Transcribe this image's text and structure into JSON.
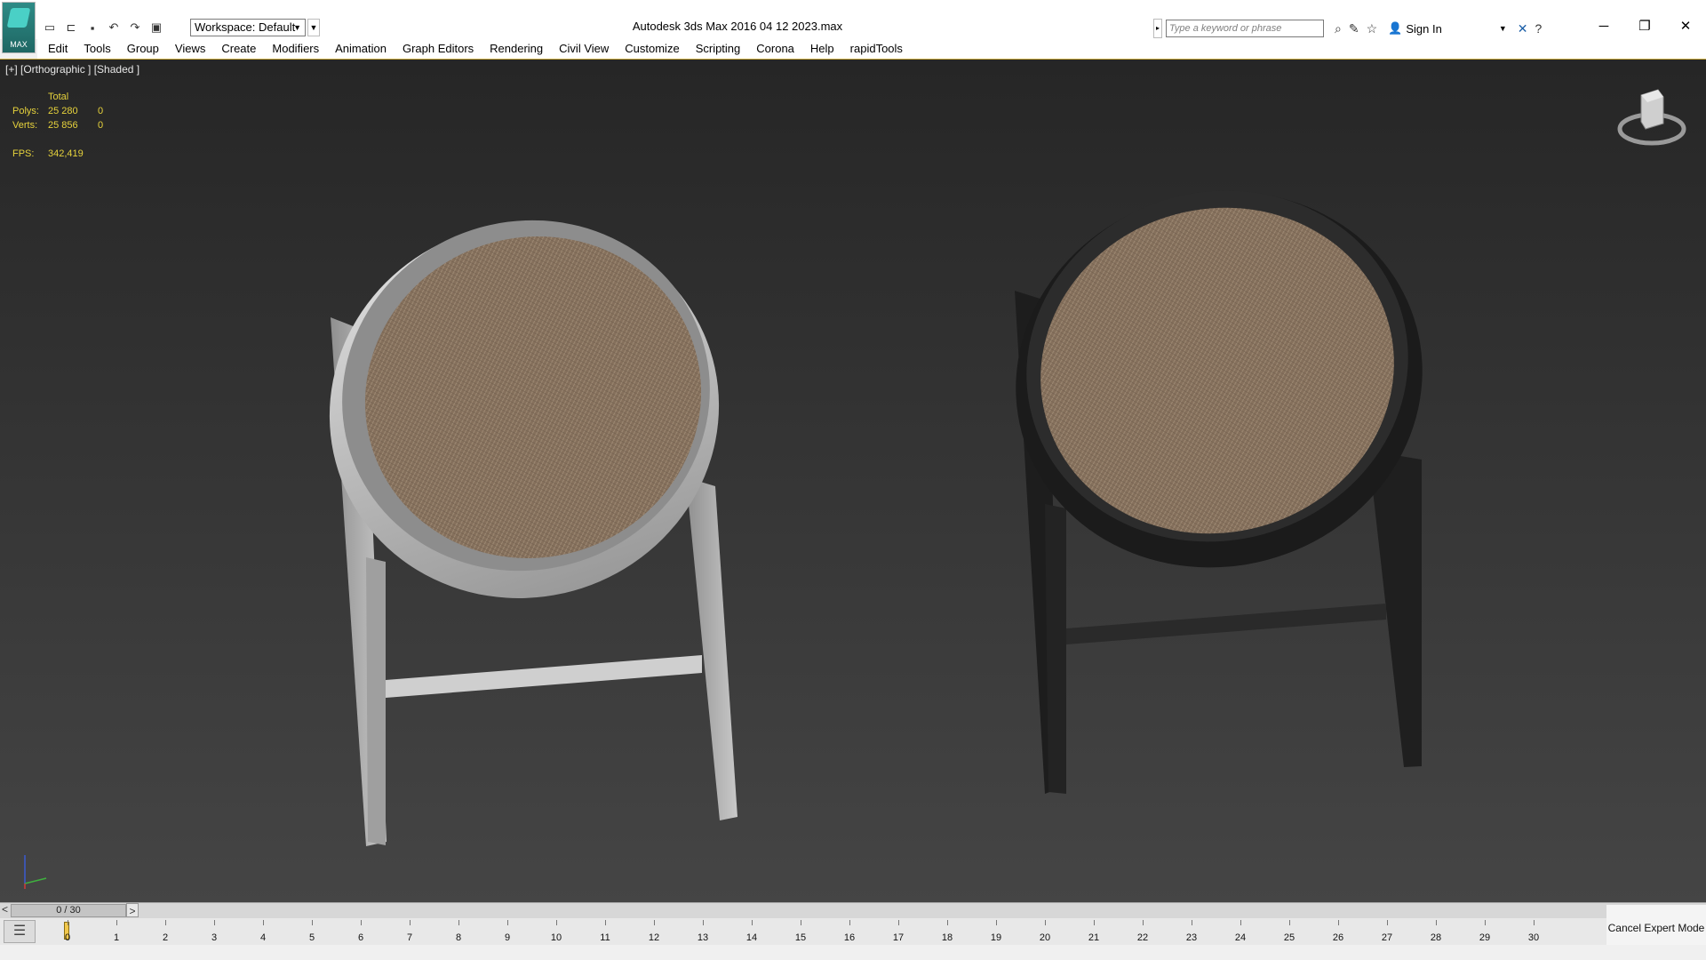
{
  "app": {
    "logo_text": "MAX",
    "window_title": "Autodesk 3ds Max 2016      04 12 2023.max",
    "workspace": "Workspace: Default",
    "search_placeholder": "Type a keyword or phrase",
    "sign_in": "Sign In"
  },
  "menu": [
    "Edit",
    "Tools",
    "Group",
    "Views",
    "Create",
    "Modifiers",
    "Animation",
    "Graph Editors",
    "Rendering",
    "Civil View",
    "Customize",
    "Scripting",
    "Corona",
    "Help",
    "rapidTools"
  ],
  "viewport": {
    "label": "[+] [Orthographic ] [Shaded ]",
    "stats": {
      "total_label": "Total",
      "polys_label": "Polys:",
      "polys_total": "25 280",
      "polys_sel": "0",
      "verts_label": "Verts:",
      "verts_total": "25 856",
      "verts_sel": "0",
      "fps_label": "FPS:",
      "fps_value": "342,419"
    },
    "colors": {
      "background": "#2e2e2e",
      "stats_text": "#e6d23c",
      "stool_light": "#b9b9b9",
      "stool_dark": "#222222",
      "seat": "#8a7663"
    }
  },
  "timeline": {
    "prev": "<",
    "next": ">",
    "slider_text": "0 / 30",
    "frames": [
      "0",
      "1",
      "2",
      "3",
      "4",
      "5",
      "6",
      "7",
      "8",
      "9",
      "10",
      "11",
      "12",
      "13",
      "14",
      "15",
      "16",
      "17",
      "18",
      "19",
      "20",
      "21",
      "22",
      "23",
      "24",
      "25",
      "26",
      "27",
      "28",
      "29",
      "30"
    ]
  },
  "status": {
    "expert_mode": "Cancel Expert Mode"
  }
}
